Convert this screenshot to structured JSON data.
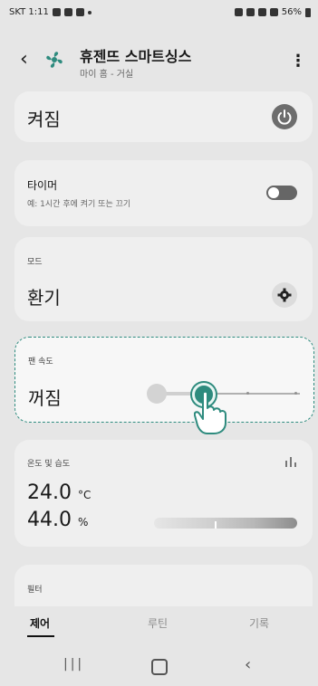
{
  "status": {
    "carrier_time": "SKT 1:11",
    "battery": "56%"
  },
  "header": {
    "title": "휴젠뜨 스마트싱스",
    "subtitle": "마이 홈 - 거실",
    "more_label": "⋮"
  },
  "power": {
    "label": "켜짐"
  },
  "timer": {
    "title": "타이머",
    "hint": "예: 1시간 후에 켜기 또는 끄기"
  },
  "mode": {
    "label": "모드",
    "value": "환기"
  },
  "fan_speed": {
    "label": "팬 속도",
    "value": "꺼짐",
    "level_fraction": 0.0
  },
  "environment": {
    "label": "온도 및 습도",
    "temperature": "24.0",
    "temp_unit": "°C",
    "humidity": "44.0",
    "humidity_unit": "%"
  },
  "filter": {
    "label": "필터"
  },
  "tabs": [
    {
      "label": "제어"
    },
    {
      "label": "루틴"
    },
    {
      "label": "기록"
    }
  ],
  "colors": {
    "accent": "#2e8b7e"
  }
}
